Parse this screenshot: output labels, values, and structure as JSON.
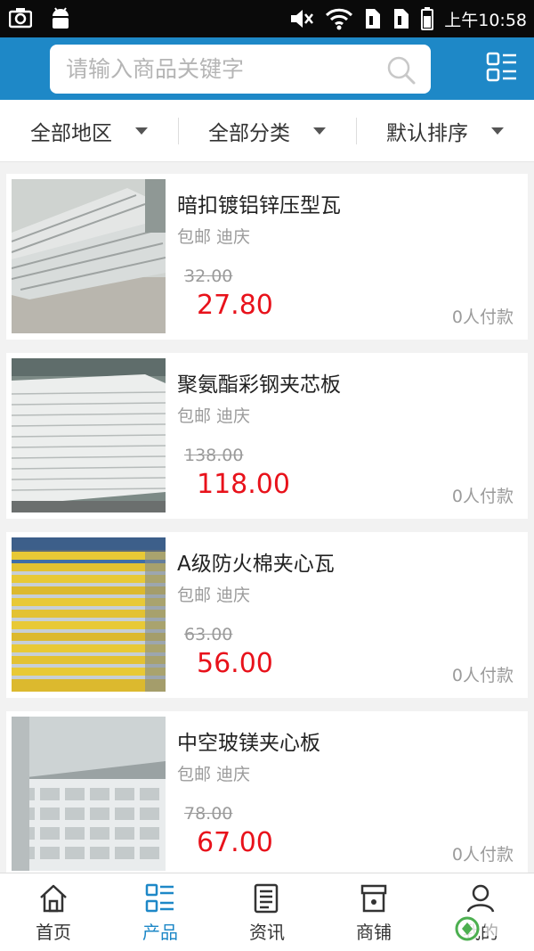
{
  "status_bar": {
    "time": "上午10:58",
    "icons": [
      "screenshot-icon",
      "android-icon",
      "mute-icon",
      "wifi-icon",
      "sim1-icon",
      "sim2-icon",
      "battery-icon"
    ]
  },
  "header": {
    "search_placeholder": "请输入商品关键字",
    "search_icon": "search-icon",
    "menu_icon": "grid-menu-icon"
  },
  "filters": [
    {
      "label": "全部地区"
    },
    {
      "label": "全部分类"
    },
    {
      "label": "默认排序"
    }
  ],
  "products": [
    {
      "name": "暗扣镀铝锌压型瓦",
      "meta": "包邮 迪庆",
      "old_price": "32.00",
      "price": "27.80",
      "paid": "0人付款"
    },
    {
      "name": "聚氨酯彩钢夹芯板",
      "meta": "包邮 迪庆",
      "old_price": "138.00",
      "price": "118.00",
      "paid": "0人付款"
    },
    {
      "name": "A级防火棉夹心瓦",
      "meta": "包邮 迪庆",
      "old_price": "63.00",
      "price": "56.00",
      "paid": "0人付款"
    },
    {
      "name": "中空玻镁夹心板",
      "meta": "包邮 迪庆",
      "old_price": "78.00",
      "price": "67.00",
      "paid": "0人付款"
    }
  ],
  "tabs": [
    {
      "label": "首页",
      "icon": "home-icon"
    },
    {
      "label": "产品",
      "icon": "product-list-icon",
      "active": true
    },
    {
      "label": "资讯",
      "icon": "news-icon"
    },
    {
      "label": "商铺",
      "icon": "shop-icon"
    },
    {
      "label": "我的",
      "icon": "user-icon"
    }
  ],
  "colors": {
    "header": "#1e88c7",
    "price": "#e8121b",
    "active_tab": "#1e88c7"
  }
}
